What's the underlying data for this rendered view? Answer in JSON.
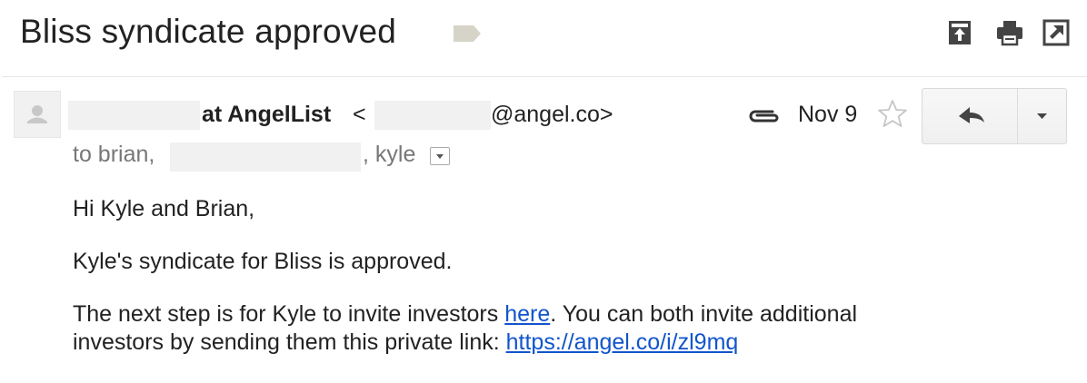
{
  "email": {
    "subject": "Bliss syndicate approved",
    "sender": {
      "name_suffix": "at AngelList",
      "email_open": "<",
      "email_domain": "@angel.co>"
    },
    "date": "Nov 9",
    "recipients": {
      "prefix": "to brian,",
      "last": ", kyle"
    },
    "body": {
      "greeting": "Hi Kyle and Brian,",
      "line1": "Kyle's syndicate for Bliss is approved.",
      "line2_before": "The next step is for Kyle to invite investors ",
      "line2_link": "here",
      "line2_after": ". You can both invite additional",
      "line3_before": "investors by sending them this private link: ",
      "line3_link": "https://angel.co/i/zl9mq"
    }
  },
  "icons": {
    "label": "label-tag-icon",
    "archive": "move-to-inbox-icon",
    "print": "print-icon",
    "popout": "open-in-new-window-icon",
    "attachment": "paperclip-icon",
    "star": "star-icon",
    "reply": "reply-icon",
    "more": "chevron-down-icon",
    "avatar": "person-icon"
  },
  "colors": {
    "link": "#1155cc",
    "muted_text": "#777777",
    "label_tag": "#d6d3c8"
  }
}
